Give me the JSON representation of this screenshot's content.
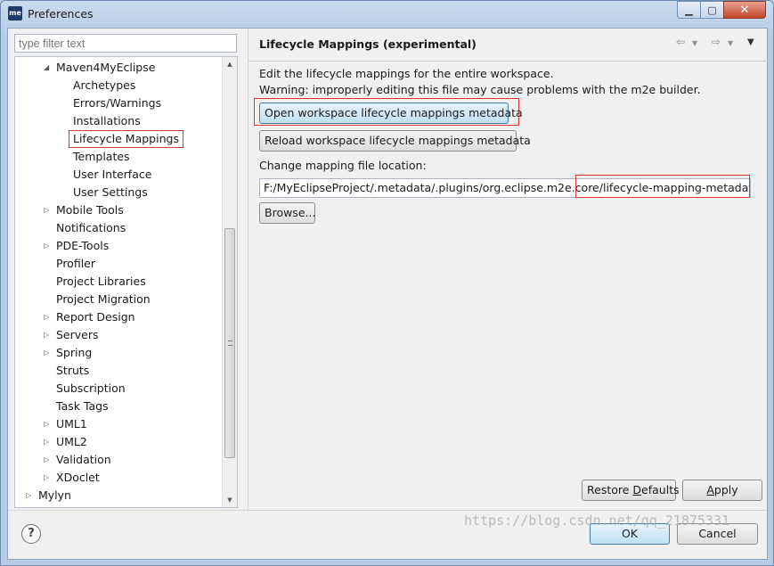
{
  "window": {
    "title": "Preferences",
    "app_icon": "me"
  },
  "filter": {
    "placeholder": "type filter text"
  },
  "tree": [
    {
      "label": "Maven4MyEclipse",
      "indent": 1,
      "arrow": "expanded"
    },
    {
      "label": "Archetypes",
      "indent": 2,
      "arrow": "none"
    },
    {
      "label": "Errors/Warnings",
      "indent": 2,
      "arrow": "none"
    },
    {
      "label": "Installations",
      "indent": 2,
      "arrow": "none"
    },
    {
      "label": "Lifecycle Mappings",
      "indent": 2,
      "arrow": "none",
      "selected": true
    },
    {
      "label": "Templates",
      "indent": 2,
      "arrow": "none"
    },
    {
      "label": "User Interface",
      "indent": 2,
      "arrow": "none"
    },
    {
      "label": "User Settings",
      "indent": 2,
      "arrow": "none"
    },
    {
      "label": "Mobile Tools",
      "indent": 1,
      "arrow": "collapsed"
    },
    {
      "label": "Notifications",
      "indent": 1,
      "arrow": "none"
    },
    {
      "label": "PDE-Tools",
      "indent": 1,
      "arrow": "collapsed"
    },
    {
      "label": "Profiler",
      "indent": 1,
      "arrow": "none"
    },
    {
      "label": "Project Libraries",
      "indent": 1,
      "arrow": "none"
    },
    {
      "label": "Project Migration",
      "indent": 1,
      "arrow": "none"
    },
    {
      "label": "Report Design",
      "indent": 1,
      "arrow": "collapsed"
    },
    {
      "label": "Servers",
      "indent": 1,
      "arrow": "collapsed"
    },
    {
      "label": "Spring",
      "indent": 1,
      "arrow": "collapsed"
    },
    {
      "label": "Struts",
      "indent": 1,
      "arrow": "none"
    },
    {
      "label": "Subscription",
      "indent": 1,
      "arrow": "none"
    },
    {
      "label": "Task Tags",
      "indent": 1,
      "arrow": "none"
    },
    {
      "label": "UML1",
      "indent": 1,
      "arrow": "collapsed"
    },
    {
      "label": "UML2",
      "indent": 1,
      "arrow": "collapsed"
    },
    {
      "label": "Validation",
      "indent": 1,
      "arrow": "collapsed"
    },
    {
      "label": "XDoclet",
      "indent": 1,
      "arrow": "collapsed"
    },
    {
      "label": "Mylyn",
      "indent": 0,
      "arrow": "collapsed"
    }
  ],
  "page": {
    "title": "Lifecycle Mappings (experimental)",
    "desc_line1": "Edit the lifecycle mappings for the entire workspace.",
    "desc_line2": "Warning: improperly editing this file may cause problems with the m2e builder.",
    "open_button": "Open workspace lifecycle mappings metadata",
    "reload_button": "Reload workspace lifecycle mappings metadata",
    "location_label": "Change mapping file location:",
    "path_prefix": "F:/MyEclipseProject/.metadata/.plugins/org.eclipse.m2e.core/",
    "path_file": "lifecycle-mapping-metadata.xml",
    "browse_button": "Browse..."
  },
  "buttons": {
    "restore_pre": "Restore ",
    "restore_ul": "D",
    "restore_post": "efaults",
    "apply_ul": "A",
    "apply_post": "pply",
    "ok": "OK",
    "cancel": "Cancel"
  },
  "watermark": "https://blog.csdn.net/qq_21875331"
}
